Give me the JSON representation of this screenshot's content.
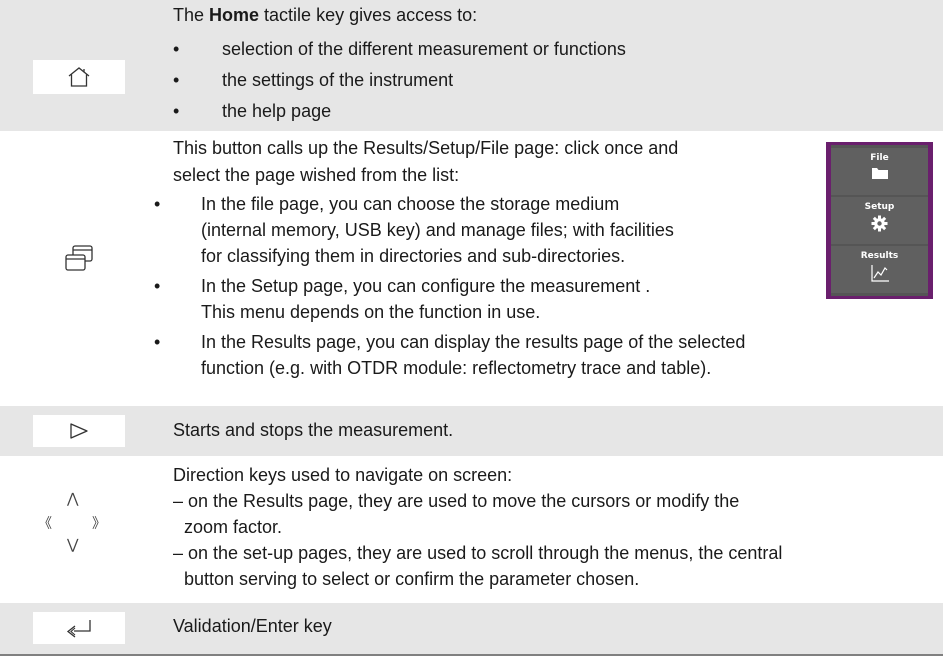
{
  "home_row": {
    "intro_before": "The ",
    "intro_bold": "Home",
    "intro_after": " tactile key gives access to:",
    "bullets": [
      "selection of the different measurement or functions",
      "the settings of the instrument",
      "the help page"
    ],
    "icon": "home-icon"
  },
  "pages_row": {
    "intro_line1": "This button calls up the Results/Setup/File page: click once and",
    "intro_line2": "select the page wished from the list:",
    "items": [
      {
        "lines": [
          "In the file page, you can choose the storage medium",
          "(internal memory, USB key) and manage files; with facilities",
          "for classifying them in directories and sub-directories."
        ]
      },
      {
        "lines": [
          "In the Setup page, you can configure the measurement .",
          "This menu depends on the function in use."
        ]
      },
      {
        "lines": [
          "In the Results page, you can display the results page of the selected",
          "function (e.g. with OTDR module: reflectometry trace and table)."
        ]
      }
    ],
    "icon": "overlapping-windows-icon",
    "menu": {
      "file_label": "File",
      "setup_label": "Setup",
      "results_label": "Results"
    }
  },
  "start_row": {
    "text": "Starts and stops the measurement.",
    "icon": "play-triangle-icon"
  },
  "direction_row": {
    "line1": "Direction keys used to navigate on screen:",
    "item1_line1": "– on the Results page, they are used to move the cursors or modify the",
    "item1_line2": "zoom factor.",
    "item2_line1": "– on the set-up pages, they are used to scroll through the menus, the central",
    "item2_line2": "button serving to select or confirm the parameter chosen.",
    "icon": "direction-keys-icon"
  },
  "enter_row": {
    "text": "Validation/Enter key",
    "icon": "enter-arrow-icon"
  },
  "colors": {
    "row_shade": "#e6e6e6",
    "menu_border": "#6a1f6d",
    "menu_button": "#606060"
  }
}
